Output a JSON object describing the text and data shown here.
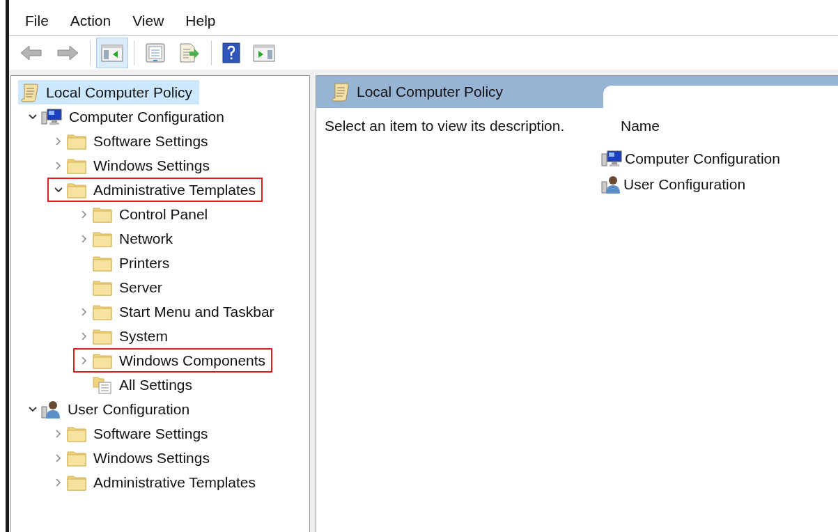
{
  "menu": [
    {
      "label": "File"
    },
    {
      "label": "Action"
    },
    {
      "label": "View"
    },
    {
      "label": "Help"
    }
  ],
  "toolbar": [
    {
      "kind": "back",
      "disabled": true,
      "pressed": false
    },
    {
      "kind": "forward",
      "disabled": true,
      "pressed": false
    },
    {
      "kind": "separator"
    },
    {
      "kind": "tree",
      "disabled": false,
      "pressed": true
    },
    {
      "kind": "separator"
    },
    {
      "kind": "properties",
      "disabled": false,
      "pressed": false
    },
    {
      "kind": "export",
      "disabled": false,
      "pressed": false
    },
    {
      "kind": "separator"
    },
    {
      "kind": "help",
      "disabled": false,
      "pressed": false
    },
    {
      "kind": "actionpane",
      "disabled": false,
      "pressed": false
    }
  ],
  "tree": [
    {
      "label": "Local Computer Policy",
      "kind": "policy",
      "selected": true,
      "highlighted": false,
      "children": [
        {
          "label": "Computer Configuration",
          "kind": "computer",
          "selected": false,
          "highlighted": false,
          "expanded": true,
          "children": [
            {
              "label": "Software Settings",
              "kind": "folder",
              "selected": false,
              "highlighted": false,
              "expanded": false
            },
            {
              "label": "Windows Settings",
              "kind": "folder",
              "selected": false,
              "highlighted": false,
              "expanded": false
            },
            {
              "label": "Administrative Templates",
              "kind": "folder",
              "selected": false,
              "highlighted": true,
              "expanded": true,
              "children": [
                {
                  "label": "Control Panel",
                  "kind": "folder",
                  "selected": false,
                  "highlighted": false,
                  "expanded": false
                },
                {
                  "label": "Network",
                  "kind": "folder",
                  "selected": false,
                  "highlighted": false,
                  "expanded": false
                },
                {
                  "label": "Printers",
                  "kind": "folder",
                  "selected": false,
                  "highlighted": false
                },
                {
                  "label": "Server",
                  "kind": "folder",
                  "selected": false,
                  "highlighted": false
                },
                {
                  "label": "Start Menu and Taskbar",
                  "kind": "folder",
                  "selected": false,
                  "highlighted": false,
                  "expanded": false
                },
                {
                  "label": "System",
                  "kind": "folder",
                  "selected": false,
                  "highlighted": false,
                  "expanded": false
                },
                {
                  "label": "Windows Components",
                  "kind": "folder",
                  "selected": false,
                  "highlighted": true,
                  "expanded": false
                },
                {
                  "label": "All Settings",
                  "kind": "allsettings",
                  "selected": false,
                  "highlighted": false
                }
              ]
            }
          ]
        },
        {
          "label": "User Configuration",
          "kind": "user",
          "selected": false,
          "highlighted": false,
          "expanded": true,
          "children": [
            {
              "label": "Software Settings",
              "kind": "folder",
              "selected": false,
              "highlighted": false,
              "expanded": false
            },
            {
              "label": "Windows Settings",
              "kind": "folder",
              "selected": false,
              "highlighted": false,
              "expanded": false
            },
            {
              "label": "Administrative Templates",
              "kind": "folder",
              "selected": false,
              "highlighted": false,
              "expanded": false
            }
          ]
        }
      ]
    }
  ],
  "details": {
    "title": "Local Computer Policy",
    "description": "Select an item to view its description.",
    "column": "Name",
    "items": [
      {
        "label": "Computer Configuration",
        "kind": "computer"
      },
      {
        "label": "User Configuration",
        "kind": "user"
      }
    ]
  }
}
